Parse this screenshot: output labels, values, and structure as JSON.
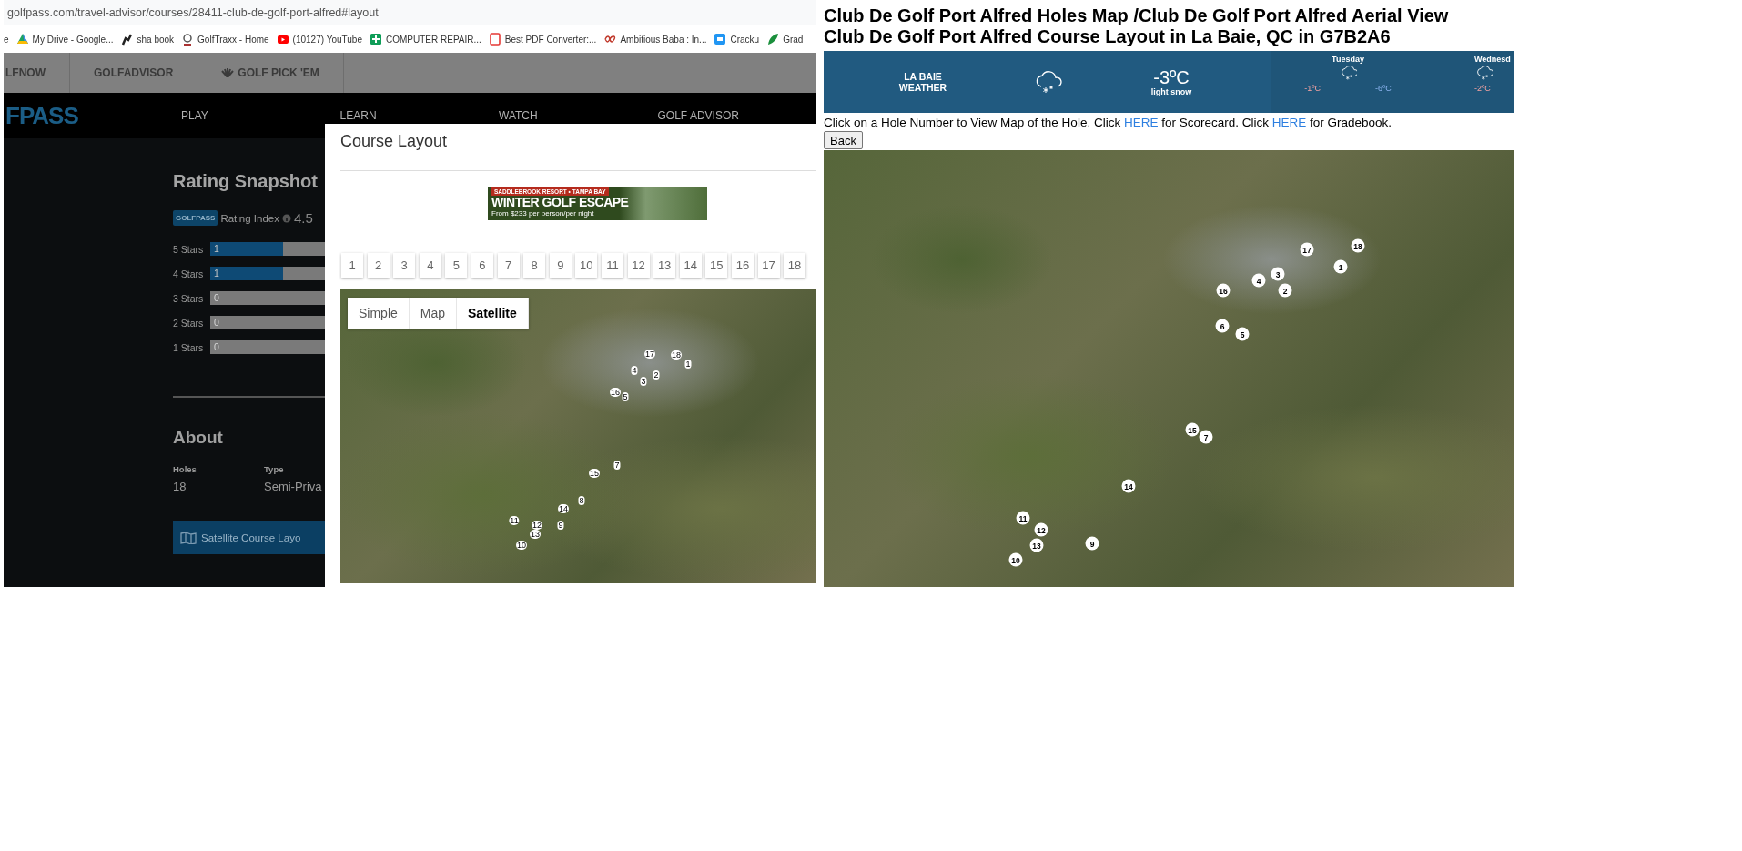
{
  "browser": {
    "url": "golfpass.com/travel-advisor/courses/28411-club-de-golf-port-alfred#layout",
    "bookmarks": [
      {
        "label": "e"
      },
      {
        "label": "My Drive - Google..."
      },
      {
        "label": "sha book"
      },
      {
        "label": "GolfTraxx - Home"
      },
      {
        "label": "(10127) YouTube"
      },
      {
        "label": "COMPUTER REPAIR..."
      },
      {
        "label": "Best PDF Converter:..."
      },
      {
        "label": "Ambitious Baba : In..."
      },
      {
        "label": "Cracku"
      },
      {
        "label": "Grad"
      }
    ]
  },
  "site_nav": {
    "links": [
      "LFNOW",
      "GOLFADVISOR",
      "GOLF PICK 'EM"
    ]
  },
  "main_nav": {
    "logo": "FPASS",
    "links": [
      "PLAY",
      "LEARN",
      "WATCH",
      "GOLF ADVISOR"
    ]
  },
  "rating": {
    "title": "Rating Snapshot",
    "badge": "GOLFPASS",
    "index_label": "Rating Index",
    "index_value": "4.5",
    "rows": [
      {
        "label": "5 Stars",
        "count": "1",
        "level": 0.25
      },
      {
        "label": "4 Stars",
        "count": "1",
        "level": 0.25
      },
      {
        "label": "3 Stars",
        "count": "0",
        "level": 0
      },
      {
        "label": "2 Stars",
        "count": "0",
        "level": 0
      },
      {
        "label": "1 Stars",
        "count": "0",
        "level": 0
      }
    ]
  },
  "about": {
    "title": "About",
    "facts": [
      {
        "label": "Holes",
        "value": "18"
      },
      {
        "label": "Type",
        "value": "Semi-Priva"
      }
    ],
    "layout_button": "Satellite Course Layo"
  },
  "modal": {
    "title": "Course Layout",
    "ad": {
      "eyebrow": "SADDLEBROOK RESORT • TAMPA BAY",
      "headline": "WINTER GOLF ESCAPE",
      "offer": "From $233 per person/per night"
    },
    "holes": [
      "1",
      "2",
      "3",
      "4",
      "5",
      "6",
      "7",
      "8",
      "9",
      "10",
      "11",
      "12",
      "13",
      "14",
      "15",
      "16",
      "17",
      "18"
    ],
    "map_types": [
      {
        "label": "Simple",
        "selected": false
      },
      {
        "label": "Map",
        "selected": false
      },
      {
        "label": "Satellite",
        "selected": true
      }
    ],
    "map_markers": [
      "17",
      "18",
      "1",
      "4",
      "2",
      "3",
      "16",
      "5",
      "7",
      "15",
      "8",
      "14",
      "11",
      "12",
      "9",
      "13",
      "10"
    ]
  },
  "aerial": {
    "heading": "Club De Golf Port Alfred Holes Map /Club De Golf Port Alfred Aerial View Club De Golf Port Alfred Course Layout in La Baie, QC in G7B2A6",
    "weather": {
      "place": "LA BAIE",
      "place_sub": "WEATHER",
      "temp": "-3ºC",
      "condition": "light snow",
      "days": [
        {
          "day": "Tuesday",
          "high": "-1ºC",
          "low": "-6ºC"
        },
        {
          "day": "Wednesd",
          "high": "-2ºC"
        }
      ]
    },
    "instructions": [
      {
        "kind": "text",
        "text": "Click on a Hole Number to View Map of the Hole. Click "
      },
      {
        "kind": "link",
        "text": "HERE"
      },
      {
        "kind": "text",
        "text": " for Scorecard. Click "
      },
      {
        "kind": "link",
        "text": "HERE"
      },
      {
        "kind": "text",
        "text": " for Gradebook."
      }
    ],
    "back_button": "Back",
    "map_markers": [
      "17",
      "18",
      "1",
      "3",
      "4",
      "16",
      "2",
      "6",
      "5",
      "15",
      "7",
      "14",
      "11",
      "12",
      "13",
      "9",
      "10"
    ]
  }
}
